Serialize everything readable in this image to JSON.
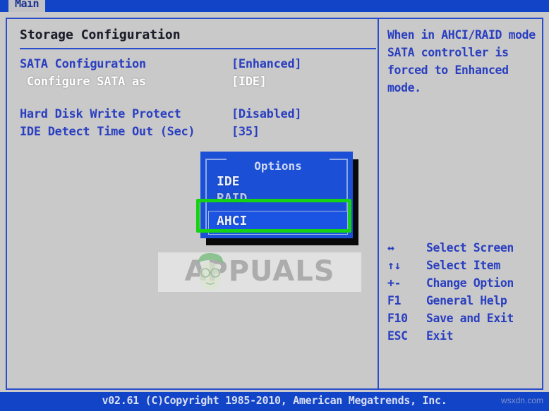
{
  "menubar": {
    "tabs": [
      {
        "label": "Main"
      }
    ]
  },
  "left_panel": {
    "title": "Storage Configuration",
    "settings": [
      {
        "label": "SATA Configuration",
        "value": "[Enhanced]",
        "sub": false
      },
      {
        "label": " Configure SATA as",
        "value": "[IDE]",
        "sub": true
      },
      {
        "label": "Hard Disk Write Protect",
        "value": "[Disabled]",
        "sub": false
      },
      {
        "label": "IDE Detect Time Out (Sec)",
        "value": "[35]",
        "sub": false
      }
    ]
  },
  "dialog": {
    "title": "Options",
    "options": [
      {
        "label": "IDE",
        "selected": false
      },
      {
        "label": "RAID",
        "selected": false
      },
      {
        "label": "AHCI",
        "selected": true
      }
    ],
    "highlight_color": "#15d215",
    "background_color": "#1a4fd6"
  },
  "right_panel": {
    "help_lines": [
      "When in AHCI/RAID mode",
      "SATA controller is",
      "forced to Enhanced",
      "mode."
    ],
    "key_legend": [
      {
        "key": "↔",
        "description": "Select Screen"
      },
      {
        "key": "↑↓",
        "description": "Select Item"
      },
      {
        "key": "+-",
        "description": "Change Option"
      },
      {
        "key": "F1",
        "description": "General Help"
      },
      {
        "key": "F10",
        "description": "Save and Exit"
      },
      {
        "key": "ESC",
        "description": "Exit"
      }
    ]
  },
  "bottom_bar": {
    "copyright": "v02.61 (C)Copyright 1985-2010, American Megatrends, Inc.",
    "watermark_site": "wsxdn.com"
  },
  "overlay_watermark": {
    "text": "APPUALS"
  },
  "colors": {
    "menu_blue": "#1244c8",
    "text_blue": "#2a3fc0",
    "panel_gray": "#c9c9c9",
    "dialog_blue": "#1a4fd6",
    "highlight_green": "#15d215"
  }
}
